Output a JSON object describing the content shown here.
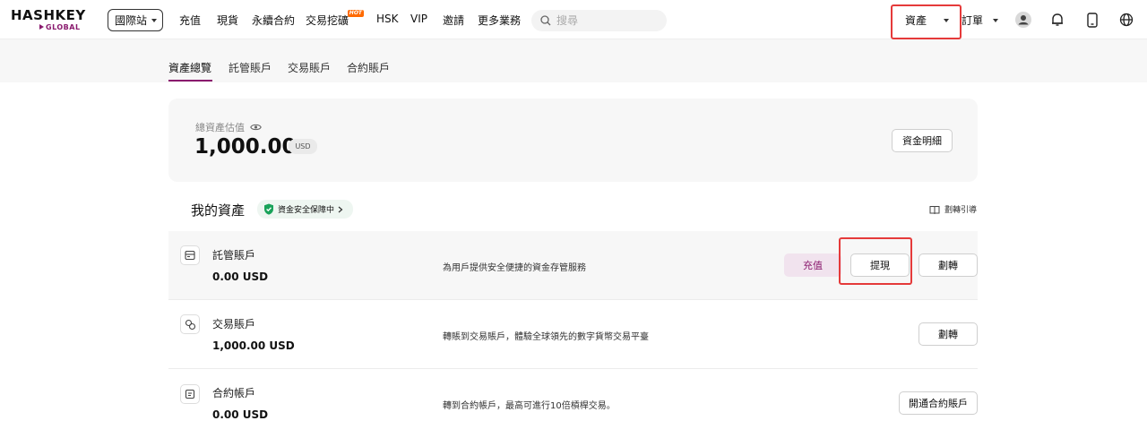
{
  "header": {
    "logo_main": "HASHKEY",
    "logo_sub": "GLOBAL",
    "site_select": "國際站",
    "nav": [
      "充值",
      "現貨",
      "永續合約",
      "交易挖礦",
      "HSK",
      "VIP",
      "邀請",
      "更多業務"
    ],
    "hot_badge": "HOT",
    "search_placeholder": "搜尋",
    "assets_menu": "資產",
    "orders_menu": "訂單"
  },
  "subnav": {
    "tabs": [
      "資產總覽",
      "託管賬戶",
      "交易賬戶",
      "合約賬戶"
    ]
  },
  "total": {
    "label": "總資產估值",
    "value": "1,000.00",
    "currency": "USD",
    "details_button": "資金明細"
  },
  "my_assets": {
    "title": "我的資產",
    "safety_badge": "資金安全保障中",
    "transfer_guide": "劃轉引導",
    "accounts": [
      {
        "name": "託管賬戶",
        "balance": "0.00 USD",
        "description": "為用戶提供安全便捷的資金存管服務",
        "deposit_label": "充值",
        "withdraw_label": "提現",
        "transfer_label": "劃轉"
      },
      {
        "name": "交易賬戶",
        "balance": "1,000.00 USD",
        "description": "轉賬到交易賬戶，體驗全球領先的數字貨幣交易平臺",
        "transfer_label": "劃轉"
      },
      {
        "name": "合約帳戶",
        "balance": "0.00 USD",
        "description": "轉到合約帳戶，最高可進行10倍槓桿交易。",
        "open_label": "開通合約賬戶"
      }
    ]
  },
  "colors": {
    "brand": "#8a1a6e",
    "highlight": "#e53a3a",
    "safe_green": "#1aa35a"
  }
}
